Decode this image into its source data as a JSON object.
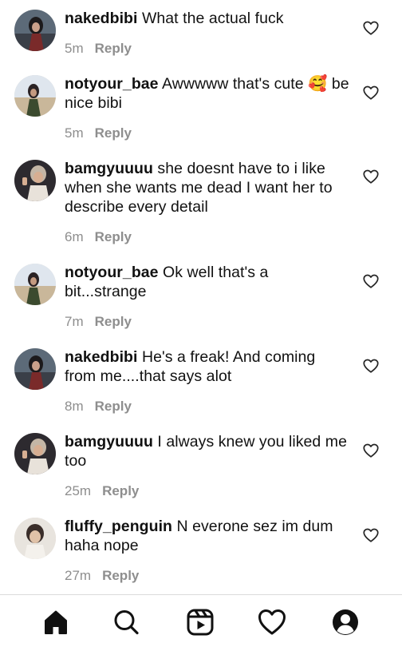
{
  "comments": [
    {
      "username": "nakedbibi",
      "text": "What the actual fuck",
      "time": "5m",
      "reply": "Reply",
      "avatar": "dark-hair-photo"
    },
    {
      "username": "notyour_bae",
      "text": "Awwwww that's cute 🥰 be nice bibi",
      "time": "5m",
      "reply": "Reply",
      "avatar": "outdoor-photo"
    },
    {
      "username": "bamgyuuuu",
      "text": "she doesnt have to i like when she wants me dead I want her to describe every detail",
      "time": "6m",
      "reply": "Reply",
      "avatar": "peace-sign-photo"
    },
    {
      "username": "notyour_bae",
      "text": "Ok well that's a bit...strange",
      "time": "7m",
      "reply": "Reply",
      "avatar": "outdoor-photo"
    },
    {
      "username": "nakedbibi",
      "text": "He's a freak! And coming from me....that says alot",
      "time": "8m",
      "reply": "Reply",
      "avatar": "dark-hair-photo"
    },
    {
      "username": "bamgyuuuu",
      "text": "I always knew you liked me too",
      "time": "25m",
      "reply": "Reply",
      "avatar": "peace-sign-photo"
    },
    {
      "username": "fluffy_penguin",
      "text": "N everone sez im dum haha nope",
      "time": "27m",
      "reply": "Reply",
      "avatar": "portrait-photo"
    }
  ],
  "tabbar": {
    "icons": [
      "home-icon",
      "search-icon",
      "reels-icon",
      "heart-icon",
      "profile-icon"
    ]
  }
}
